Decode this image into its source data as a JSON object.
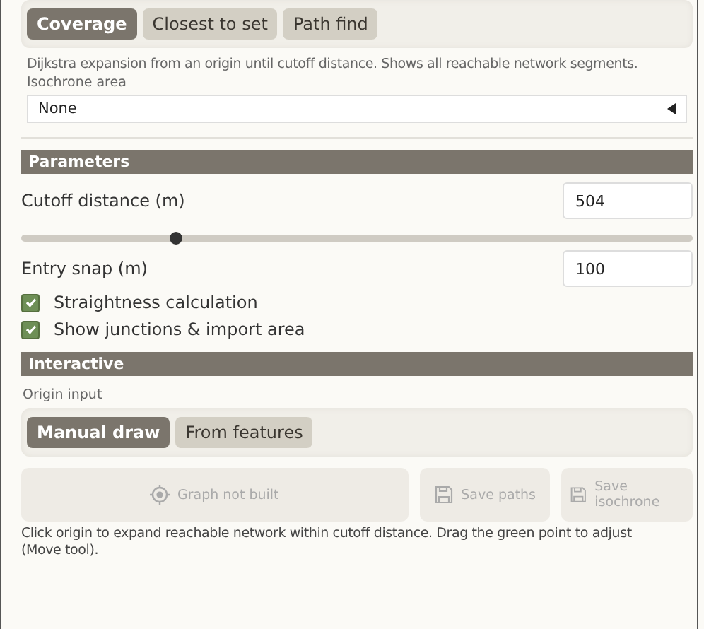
{
  "mode_tabs": [
    {
      "label": "Coverage",
      "selected": true
    },
    {
      "label": "Closest to set",
      "selected": false
    },
    {
      "label": "Path find",
      "selected": false
    }
  ],
  "description": "Dijkstra expansion from an origin until cutoff distance. Shows all reachable network segments.",
  "isochrone": {
    "label": "Isochrone area",
    "value": "None"
  },
  "parameters": {
    "title": "Parameters",
    "cutoff": {
      "label": "Cutoff distance (m)",
      "value": "504",
      "level": 0.23
    },
    "snap": {
      "label": "Entry snap (m)",
      "value": "100"
    },
    "options": [
      {
        "label": "Straightness calculation",
        "checked": true
      },
      {
        "label": "Show junctions & import area",
        "checked": true
      }
    ]
  },
  "interactive": {
    "title": "Interactive",
    "origin_label": "Origin input",
    "origin_tabs": [
      {
        "label": "Manual draw",
        "selected": true
      },
      {
        "label": "From features",
        "selected": false
      }
    ],
    "actions": [
      {
        "kind": "target",
        "label": "Graph not built",
        "disabled": true
      },
      {
        "kind": "save",
        "label": "Save paths",
        "disabled": true
      },
      {
        "kind": "save",
        "label": "Save isochrone",
        "disabled": true
      }
    ],
    "hint": "Click origin to expand reachable network within cutoff distance. Drag the green point to adjust (Move tool)."
  }
}
